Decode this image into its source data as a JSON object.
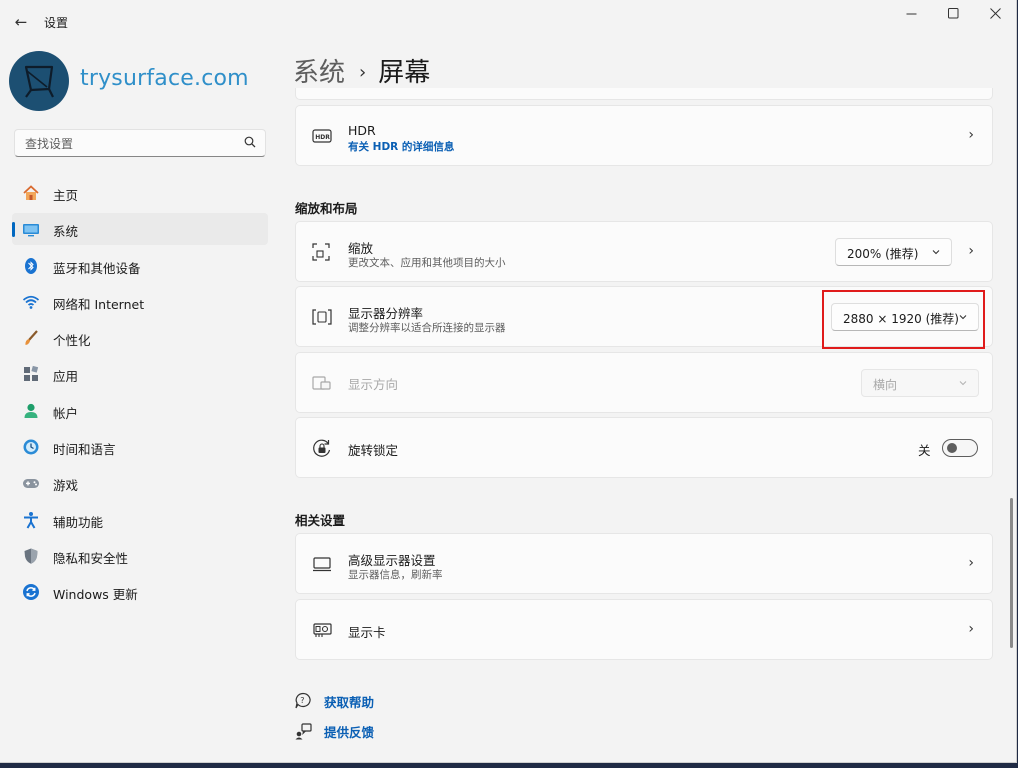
{
  "window": {
    "title": "设置",
    "back_icon": "back-arrow-icon"
  },
  "brand": {
    "text": "trysurface.com"
  },
  "search": {
    "placeholder": "查找设置"
  },
  "nav": [
    {
      "label": "主页",
      "icon": "home-icon",
      "selected": false
    },
    {
      "label": "系统",
      "icon": "system-icon",
      "selected": true
    },
    {
      "label": "蓝牙和其他设备",
      "icon": "bluetooth-icon",
      "selected": false
    },
    {
      "label": "网络和 Internet",
      "icon": "wifi-icon",
      "selected": false
    },
    {
      "label": "个性化",
      "icon": "brush-icon",
      "selected": false
    },
    {
      "label": "应用",
      "icon": "apps-icon",
      "selected": false
    },
    {
      "label": "帐户",
      "icon": "account-icon",
      "selected": false
    },
    {
      "label": "时间和语言",
      "icon": "time-language-icon",
      "selected": false
    },
    {
      "label": "游戏",
      "icon": "gamepad-icon",
      "selected": false
    },
    {
      "label": "辅助功能",
      "icon": "accessibility-icon",
      "selected": false
    },
    {
      "label": "隐私和安全性",
      "icon": "shield-icon",
      "selected": false
    },
    {
      "label": "Windows 更新",
      "icon": "update-icon",
      "selected": false
    }
  ],
  "breadcrumb": {
    "parent": "系统",
    "separator": "›",
    "current": "屏幕"
  },
  "hdr": {
    "title": "HDR",
    "link": "有关 HDR 的详细信息"
  },
  "sections": {
    "scale_layout": "缩放和布局",
    "related": "相关设置"
  },
  "scale": {
    "title": "缩放",
    "subtitle": "更改文本、应用和其他项目的大小",
    "value": "200% (推荐)"
  },
  "resolution": {
    "title": "显示器分辨率",
    "subtitle": "调整分辨率以适合所连接的显示器",
    "value": "2880 × 1920 (推荐)"
  },
  "orientation": {
    "title": "显示方向",
    "value": "横向",
    "disabled": true
  },
  "rotation_lock": {
    "title": "旋转锁定",
    "state_label": "关",
    "on": false
  },
  "advanced_display": {
    "title": "高级显示器设置",
    "subtitle": "显示器信息，刷新率"
  },
  "graphics": {
    "title": "显示卡"
  },
  "help": {
    "get_help": "获取帮助",
    "feedback": "提供反馈"
  },
  "colors": {
    "accent": "#0067c0",
    "highlight": "#e01b1b",
    "link": "#0a5fb4"
  }
}
